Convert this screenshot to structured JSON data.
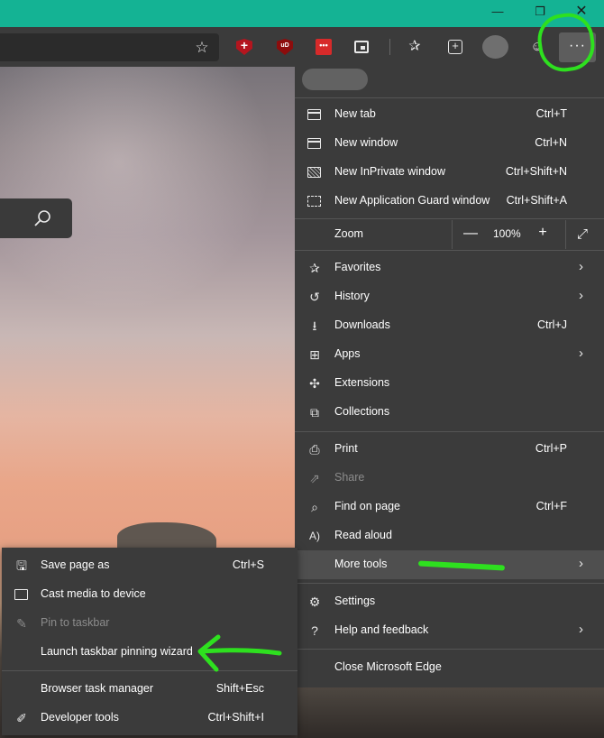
{
  "titlebar": {
    "minimize": "—",
    "restore": "❐",
    "close": "✕"
  },
  "toolbar": {
    "favorite_star": "☆",
    "ext_ublock": "uD",
    "ext_dots": "•••",
    "menu_button": "···",
    "favorites_glyph": "✰",
    "feedback_glyph": "☺"
  },
  "zoom": {
    "label": "Zoom",
    "minus": "—",
    "value": "100%",
    "plus": "+",
    "fullscreen": "⤢"
  },
  "main_menu": {
    "new_tab": {
      "label": "New tab",
      "shortcut": "Ctrl+T"
    },
    "new_window": {
      "label": "New window",
      "shortcut": "Ctrl+N"
    },
    "new_inprivate": {
      "label": "New InPrivate window",
      "shortcut": "Ctrl+Shift+N"
    },
    "new_guard": {
      "label": "New Application Guard window",
      "shortcut": "Ctrl+Shift+A"
    },
    "favorites": {
      "label": "Favorites"
    },
    "history": {
      "label": "History"
    },
    "downloads": {
      "label": "Downloads",
      "shortcut": "Ctrl+J"
    },
    "apps": {
      "label": "Apps"
    },
    "extensions": {
      "label": "Extensions"
    },
    "collections": {
      "label": "Collections"
    },
    "print": {
      "label": "Print",
      "shortcut": "Ctrl+P"
    },
    "share": {
      "label": "Share"
    },
    "find": {
      "label": "Find on page",
      "shortcut": "Ctrl+F"
    },
    "read_aloud": {
      "label": "Read aloud"
    },
    "more_tools": {
      "label": "More tools"
    },
    "settings": {
      "label": "Settings"
    },
    "help": {
      "label": "Help and feedback"
    },
    "close_edge": {
      "label": "Close Microsoft Edge"
    },
    "chevron": "›"
  },
  "sub_menu": {
    "save_page": {
      "label": "Save page as",
      "shortcut": "Ctrl+S"
    },
    "cast": {
      "label": "Cast media to device"
    },
    "pin": {
      "label": "Pin to taskbar"
    },
    "launch_wizard": {
      "label": "Launch taskbar pinning wizard"
    },
    "task_manager": {
      "label": "Browser task manager",
      "shortcut": "Shift+Esc"
    },
    "dev_tools": {
      "label": "Developer tools",
      "shortcut": "Ctrl+Shift+I"
    }
  },
  "colors": {
    "titlebar": "#14b394",
    "menu_bg": "#3b3b3b",
    "highlight": "#4f4f4f",
    "annotation": "#2ee01f"
  }
}
